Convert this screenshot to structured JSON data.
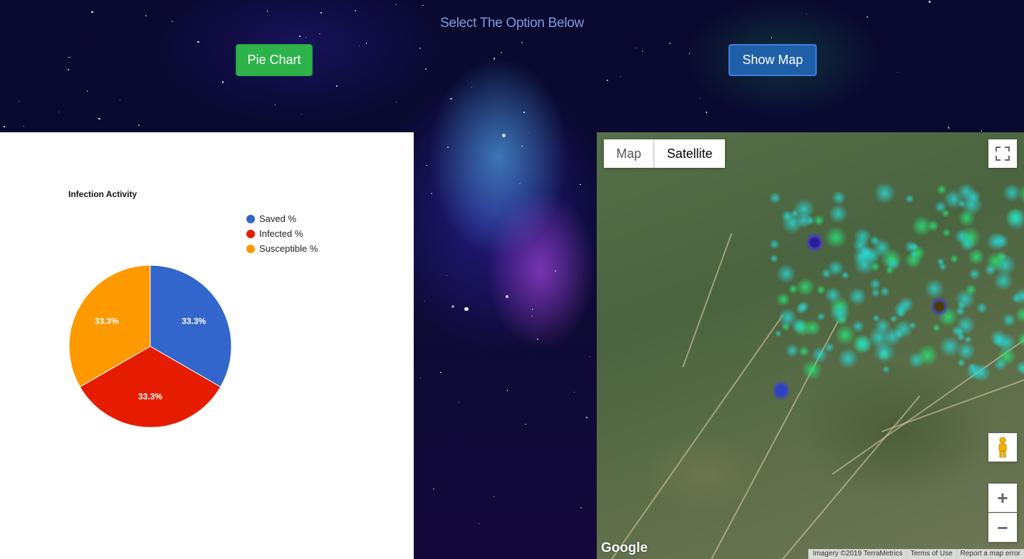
{
  "header": {
    "heading": "Select The Option Below"
  },
  "buttons": {
    "pie_chart": "Pie Chart",
    "show_map": "Show Map"
  },
  "colors": {
    "pie_button": "#2db34a",
    "map_button": "#1f5fa8"
  },
  "chart_data": {
    "type": "pie",
    "title": "Infection Activity",
    "legend_position": "right",
    "categories": [
      "Saved %",
      "Infected %",
      "Susceptible %"
    ],
    "values": [
      33.3,
      33.3,
      33.3
    ],
    "labels": [
      "33.3%",
      "33.3%",
      "33.3%"
    ],
    "colors": [
      "#3366cc",
      "#e61c00",
      "#ff9900"
    ]
  },
  "map": {
    "tabs": [
      "Map",
      "Satellite"
    ],
    "active_tab": "Satellite",
    "icons": [
      "fullscreen-icon",
      "pegman-icon",
      "zoom-in-icon",
      "zoom-out-icon"
    ],
    "logo": "Google",
    "attribution": [
      "Imagery ©2019 TerraMetrics",
      "Terms of Use",
      "Report a map error"
    ]
  }
}
